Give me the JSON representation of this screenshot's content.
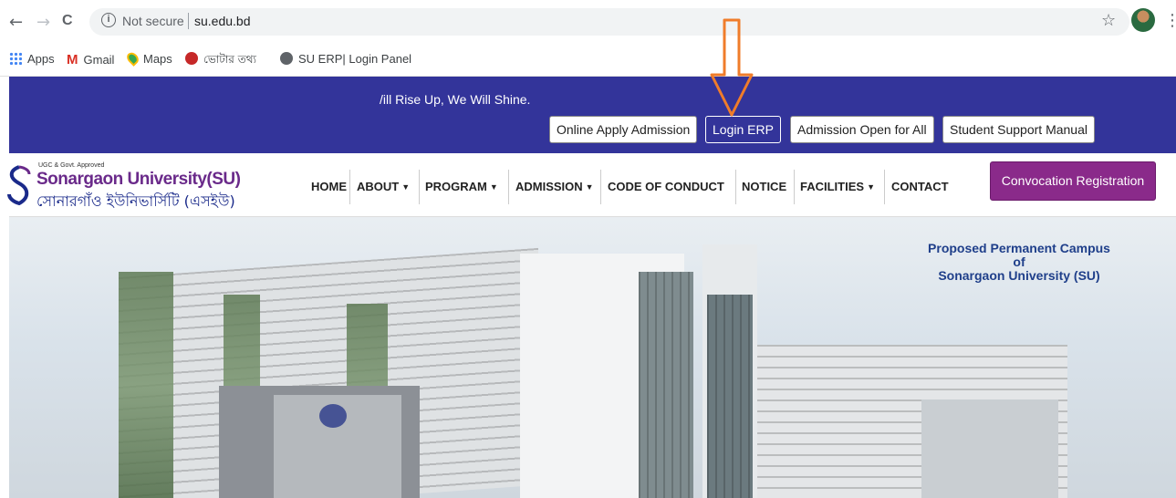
{
  "browser": {
    "nav": {
      "back": "←",
      "forward": "→",
      "reload": "C"
    },
    "security": "Not secure",
    "url": "su.edu.bd",
    "bookmarks": [
      {
        "label": "Apps",
        "icon": "apps-grid-icon"
      },
      {
        "label": "Gmail",
        "icon": "gmail-icon"
      },
      {
        "label": "Maps",
        "icon": "maps-icon"
      },
      {
        "label": "ভোটার তথ্য",
        "icon": "voter-info-icon"
      },
      {
        "label": "SU ERP| Login Panel",
        "icon": "globe-icon"
      }
    ]
  },
  "topbar": {
    "tagline": "/ill Rise Up, We Will Shine.",
    "buttons": [
      {
        "label": "Online Apply Admission"
      },
      {
        "label": "Login ERP"
      },
      {
        "label": "Admission Open for All"
      },
      {
        "label": "Student Support Manual"
      }
    ]
  },
  "header": {
    "approval": "UGC & Govt. Approved",
    "name": "Sonargaon University(SU)",
    "name_bn": "সোনারগাঁও ইউনিভার্সিটি (এসইউ)",
    "nav": [
      {
        "label": "HOME",
        "dropdown": false
      },
      {
        "label": "ABOUT",
        "dropdown": true
      },
      {
        "label": "PROGRAM",
        "dropdown": true
      },
      {
        "label": "ADMISSION",
        "dropdown": true
      },
      {
        "label": "CODE OF CONDUCT",
        "dropdown": false
      },
      {
        "label": "NOTICE",
        "dropdown": false
      },
      {
        "label": "FACILITIES",
        "dropdown": true
      },
      {
        "label": "CONTACT",
        "dropdown": false
      }
    ],
    "cta": "Convocation Registration"
  },
  "hero": {
    "caption_line1": "Proposed Permanent Campus",
    "caption_line2": "of",
    "caption_line3": "Sonargaon University (SU)"
  },
  "colors": {
    "topbar_bg": "#33349a",
    "cta_bg": "#8a2a8a",
    "arrow": "#f07c2a",
    "caption": "#1f3f8a"
  }
}
